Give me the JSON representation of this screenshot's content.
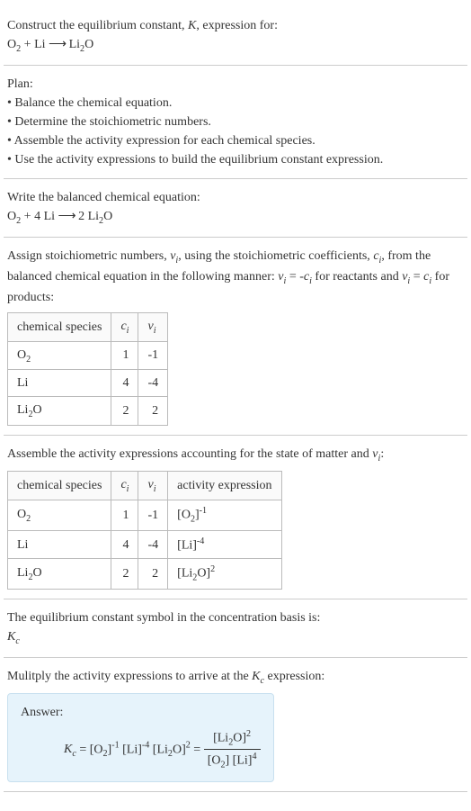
{
  "intro": {
    "heading": "Construct the equilibrium constant, K, expression for:",
    "equation": "O₂ + Li ⟶ Li₂O"
  },
  "plan": {
    "heading": "Plan:",
    "items": [
      "• Balance the chemical equation.",
      "• Determine the stoichiometric numbers.",
      "• Assemble the activity expression for each chemical species.",
      "• Use the activity expressions to build the equilibrium constant expression."
    ]
  },
  "balanced": {
    "heading": "Write the balanced chemical equation:",
    "equation": "O₂ + 4 Li ⟶ 2 Li₂O"
  },
  "stoich": {
    "heading": "Assign stoichiometric numbers, νᵢ, using the stoichiometric coefficients, cᵢ, from the balanced chemical equation in the following manner: νᵢ = -cᵢ for reactants and νᵢ = cᵢ for products:",
    "headers": [
      "chemical species",
      "cᵢ",
      "νᵢ"
    ],
    "rows": [
      {
        "species": "O₂",
        "c": "1",
        "nu": "-1"
      },
      {
        "species": "Li",
        "c": "4",
        "nu": "-4"
      },
      {
        "species": "Li₂O",
        "c": "2",
        "nu": "2"
      }
    ]
  },
  "activity": {
    "heading": "Assemble the activity expressions accounting for the state of matter and νᵢ:",
    "headers": [
      "chemical species",
      "cᵢ",
      "νᵢ",
      "activity expression"
    ],
    "rows": [
      {
        "species": "O₂",
        "c": "1",
        "nu": "-1",
        "expr": "[O₂]⁻¹"
      },
      {
        "species": "Li",
        "c": "4",
        "nu": "-4",
        "expr": "[Li]⁻⁴"
      },
      {
        "species": "Li₂O",
        "c": "2",
        "nu": "2",
        "expr": "[Li₂O]²"
      }
    ]
  },
  "symbol": {
    "heading": "The equilibrium constant symbol in the concentration basis is:",
    "value": "K_c"
  },
  "multiply": {
    "heading": "Mulitply the activity expressions to arrive at the K_c expression:"
  },
  "answer": {
    "label": "Answer:",
    "lhs": "K_c = [O₂]⁻¹ [Li]⁻⁴ [Li₂O]² =",
    "frac_num": "[Li₂O]²",
    "frac_den": "[O₂] [Li]⁴"
  },
  "chart_data": {
    "type": "table",
    "tables": [
      {
        "title": "Stoichiometric numbers",
        "headers": [
          "chemical species",
          "c_i",
          "ν_i"
        ],
        "rows": [
          [
            "O2",
            1,
            -1
          ],
          [
            "Li",
            4,
            -4
          ],
          [
            "Li2O",
            2,
            2
          ]
        ]
      },
      {
        "title": "Activity expressions",
        "headers": [
          "chemical species",
          "c_i",
          "ν_i",
          "activity expression"
        ],
        "rows": [
          [
            "O2",
            1,
            -1,
            "[O2]^-1"
          ],
          [
            "Li",
            4,
            -4,
            "[Li]^-4"
          ],
          [
            "Li2O",
            2,
            2,
            "[Li2O]^2"
          ]
        ]
      }
    ],
    "equilibrium_expression": "K_c = [Li2O]^2 / ([O2] * [Li]^4)"
  }
}
